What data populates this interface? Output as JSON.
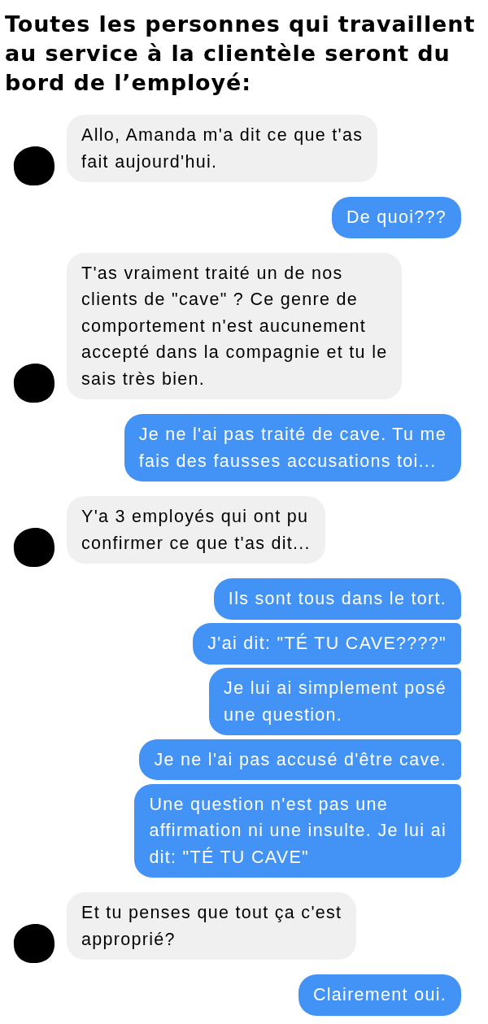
{
  "title": "Toutes les personnes qui travaillent\nau service à la clientèle seront du\nbord de l’employé:",
  "groups": [
    {
      "kind": "received",
      "messages": [
        "Allo, Amanda m'a dit ce que t'as\nfait aujourd'hui."
      ]
    },
    {
      "kind": "sent",
      "messages": [
        "De quoi???"
      ]
    },
    {
      "kind": "received",
      "messages": [
        "T'as vraiment traité un de nos\nclients de \"cave\" ? Ce genre de\ncomportement n'est aucunement\naccepté dans la compagnie et tu le\nsais très bien."
      ]
    },
    {
      "kind": "sent",
      "messages": [
        "Je ne l'ai pas traité de cave. Tu me\nfais des fausses accusations toi..."
      ]
    },
    {
      "kind": "received",
      "messages": [
        "Y'a 3 employés qui ont pu\nconfirmer ce que t'as dit..."
      ]
    },
    {
      "kind": "sent",
      "messages": [
        "Ils sont tous dans le tort.",
        "J'ai dit: \"TÉ TU CAVE????\"",
        "Je lui ai simplement posé\nune question.",
        "Je ne l'ai pas accusé d'être cave.",
        "Une question n'est pas une\naffirmation ni une insulte. Je lui ai\ndit: \"TÉ TU CAVE\""
      ]
    },
    {
      "kind": "received",
      "messages": [
        "Et tu penses que tout ça c'est\napproprié?"
      ]
    },
    {
      "kind": "sent",
      "messages": [
        "Clairement oui."
      ]
    }
  ]
}
